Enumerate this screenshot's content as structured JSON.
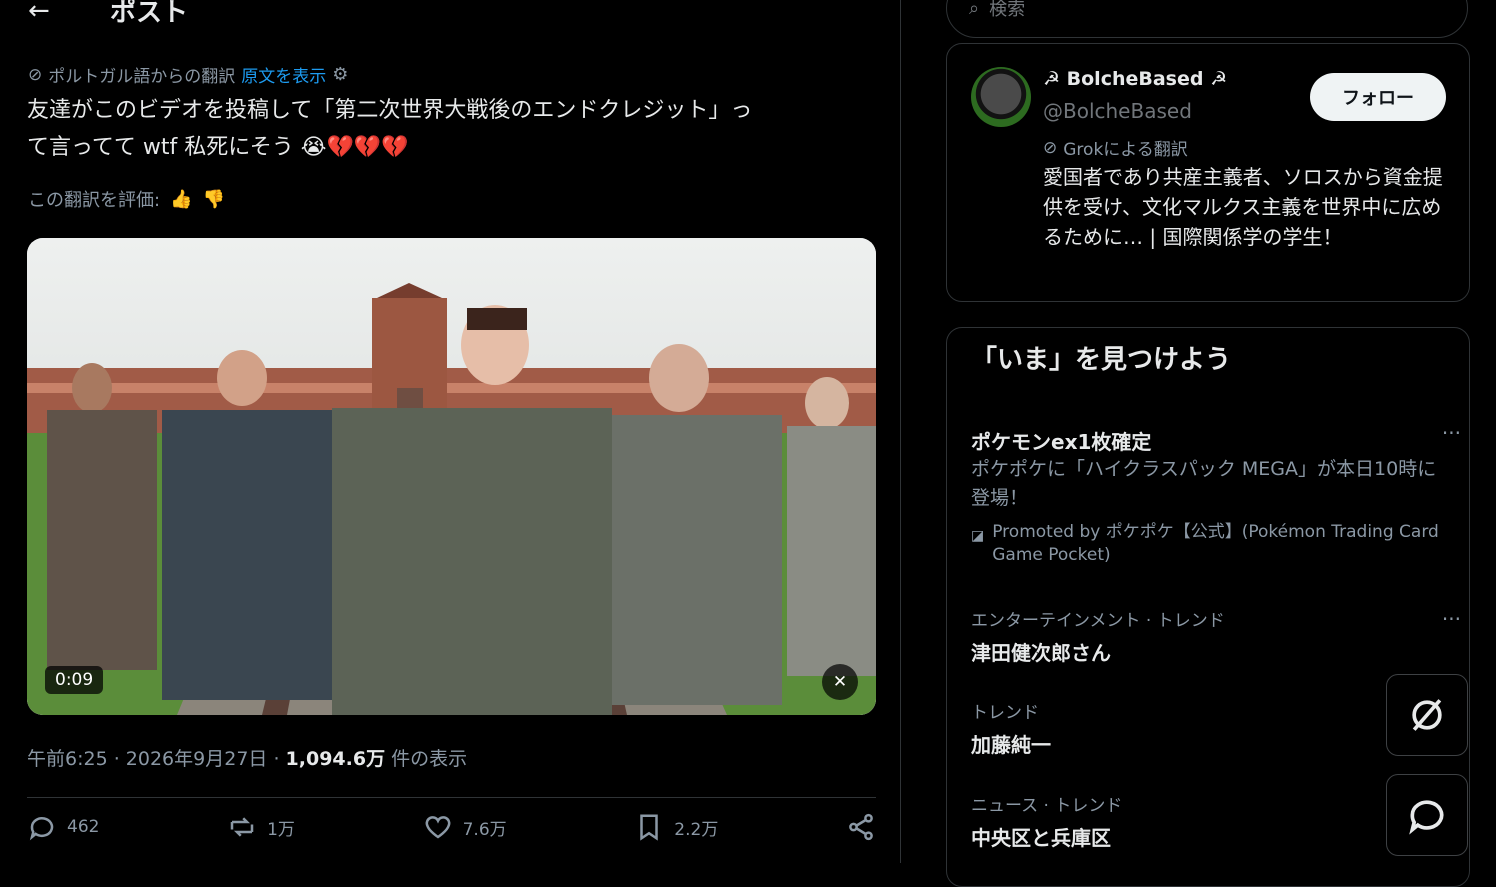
{
  "header": {
    "back_icon": "arrow-left-icon",
    "title": "ポスト"
  },
  "post": {
    "translation_note": "ポルトガル語からの翻訳",
    "show_original": "原文を表示",
    "text_line1": "友達がこのビデオを投稿して「第二次世界大戦後のエンドクレジット」っ",
    "text_line2": "て言ってて wtf 私死にそう 😭💔💔💔",
    "rate_label": "この翻訳を評価:",
    "video": {
      "duration": "0:09",
      "mute_icon": "mute-icon"
    },
    "time": "午前6:25 · 2026年9月27日 · ",
    "views_count": "1,094.6万",
    "views_label": " 件の表示",
    "actions": {
      "replies": "462",
      "reposts": "1万",
      "likes": "7.6万",
      "bookmarks": "2.2万"
    }
  },
  "sidebar": {
    "search_placeholder": "検索",
    "profile": {
      "name": "☭ BolcheBased ☭",
      "handle": "@BolcheBased",
      "follow": "フォロー",
      "grok_note": "Grokによる翻訳",
      "bio": "愛国者であり共産主義者、ソロスから資金提供を受け、文化マルクス主義を世界中に広めるために… | 国際関係学の学生！"
    },
    "explore": {
      "title": "「いま」を見つけよう",
      "trends": [
        {
          "category": "",
          "title": "ポケモンex1枚確定",
          "desc": "ポケポケに「ハイクラスパック MEGA」が本日10時に登場！",
          "promo": "Promoted by ポケポケ【公式】(Pokémon Trading Card Game Pocket)"
        },
        {
          "category": "エンターテインメント · トレンド",
          "title": "津田健次郎さん"
        },
        {
          "category": "トレンド",
          "title": "加藤純一"
        },
        {
          "category": "ニュース · トレンド",
          "title": "中央区と兵庫区"
        }
      ]
    }
  }
}
